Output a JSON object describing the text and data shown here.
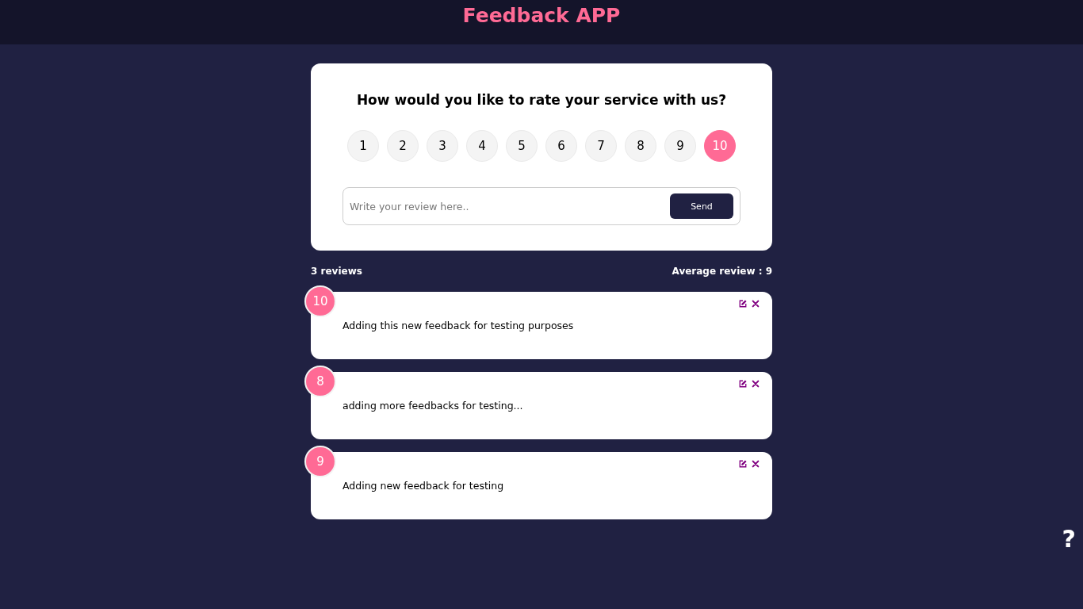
{
  "header": {
    "title": "Feedback APP"
  },
  "rating_form": {
    "question": "How would you like to rate your service with us?",
    "options": [
      {
        "label": "1",
        "selected": false
      },
      {
        "label": "2",
        "selected": false
      },
      {
        "label": "3",
        "selected": false
      },
      {
        "label": "4",
        "selected": false
      },
      {
        "label": "5",
        "selected": false
      },
      {
        "label": "6",
        "selected": false
      },
      {
        "label": "7",
        "selected": false
      },
      {
        "label": "8",
        "selected": false
      },
      {
        "label": "9",
        "selected": false
      },
      {
        "label": "10",
        "selected": true
      }
    ],
    "review_input": {
      "placeholder": "Write your review here.."
    },
    "send_button": "Send"
  },
  "stats": {
    "count": "3 reviews",
    "average": "Average review : 9"
  },
  "reviews": [
    {
      "rating": "10",
      "text": "Adding this new feedback for testing purposes"
    },
    {
      "rating": "8",
      "text": "adding more feedbacks for testing..."
    },
    {
      "rating": "9",
      "text": "Adding new feedback for testing"
    }
  ],
  "help_link": "?"
}
